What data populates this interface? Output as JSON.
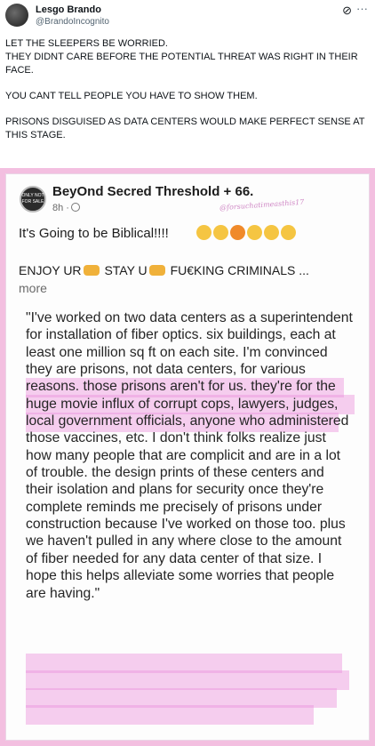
{
  "tweet": {
    "author_name": "Lesgo Brando",
    "author_handle": "@BrandoIncognito",
    "paragraphs": [
      "LET THE SLEEPERS  BE WORRIED.\nTHEY DIDNT CARE BEFORE THE POTENTIAL THREAT WAS RIGHT IN THEIR FACE.",
      "YOU CANT TELL PEOPLE YOU HAVE TO SHOW THEM.",
      "PRISONS DISGUISED AS DATA CENTERS WOULD MAKE PERFECT SENSE AT THIS STAGE."
    ]
  },
  "icons": {
    "grok": "grok-icon",
    "more": "more-icon",
    "globe": "globe-icon"
  },
  "fb_post": {
    "page_name": "BeyOnd Secred Threshold + 66.",
    "time": "8h ·",
    "watermark": "@forsuchatimeasthis17",
    "avatar_text": "ONLY NOT FOR SALE",
    "caption": "It's Going to be Biblical!!!!",
    "line2_a": "ENJOY UR",
    "line2_b": "STAY U",
    "line2_c": "FU€KING CRIMINALS ...",
    "more": "more",
    "quote": "\"I've worked on two data centers as a superintendent for installation of fiber optics. six buildings, each at least one million sq ft on each site. I'm convinced they are prisons, not data centers, for various reasons. those prisons aren't for us. they're for the huge movie influx of corrupt cops, lawyers, judges, local government officials, anyone who administered those vaccines, etc. I don't think folks realize just how many people that are complicit and are in a lot of trouble. the design prints of these centers and their isolation and plans for security once they're complete reminds me precisely of prisons under construction because I've worked on those too. plus we haven't pulled in any where close to the amount of fiber needed for any data center of that size. I hope this helps alleviate some worries that people are having.\""
  },
  "colors": {
    "highlight": "#ec92dc",
    "frame": "#f3bfe0"
  }
}
